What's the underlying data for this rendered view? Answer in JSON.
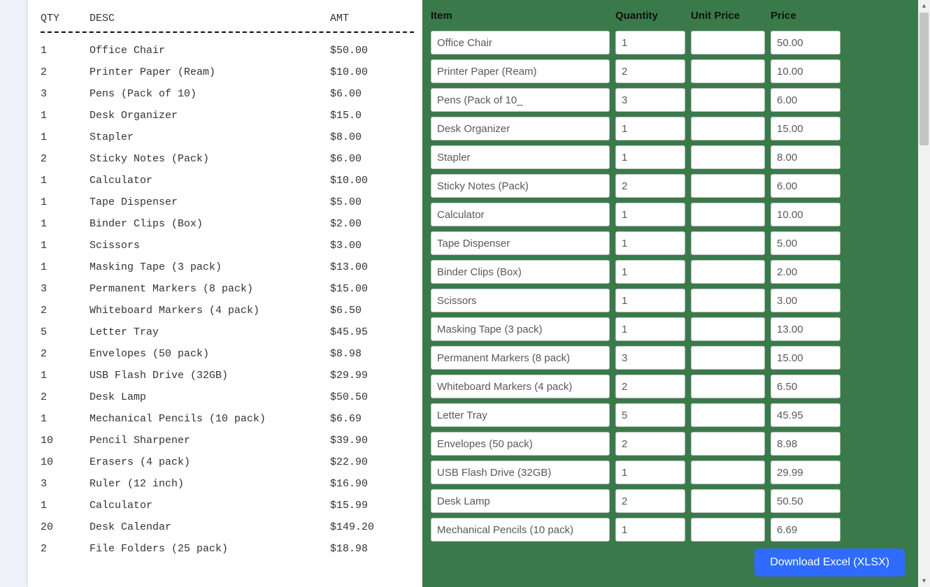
{
  "receipt": {
    "headers": {
      "qty": "QTY",
      "desc": "DESC",
      "amt": "AMT"
    },
    "rows": [
      {
        "qty": "1",
        "desc": "Office Chair",
        "amt": "$50.00"
      },
      {
        "qty": "2",
        "desc": "Printer Paper (Ream)",
        "amt": "$10.00"
      },
      {
        "qty": "3",
        "desc": "Pens (Pack of 10)",
        "amt": "$6.00"
      },
      {
        "qty": "1",
        "desc": "Desk Organizer",
        "amt": "$15.0"
      },
      {
        "qty": "1",
        "desc": "Stapler",
        "amt": "$8.00"
      },
      {
        "qty": "2",
        "desc": "Sticky Notes (Pack)",
        "amt": "$6.00"
      },
      {
        "qty": "1",
        "desc": "Calculator",
        "amt": "$10.00"
      },
      {
        "qty": "1",
        "desc": "Tape Dispenser",
        "amt": "$5.00"
      },
      {
        "qty": "1",
        "desc": "Binder Clips (Box)",
        "amt": "$2.00"
      },
      {
        "qty": "1",
        "desc": "Scissors",
        "amt": "$3.00"
      },
      {
        "qty": "1",
        "desc": "Masking Tape (3 pack)",
        "amt": "$13.00"
      },
      {
        "qty": "3",
        "desc": "Permanent Markers (8 pack)",
        "amt": "$15.00"
      },
      {
        "qty": "2",
        "desc": "Whiteboard Markers (4 pack)",
        "amt": "$6.50"
      },
      {
        "qty": "5",
        "desc": "Letter Tray",
        "amt": "$45.95"
      },
      {
        "qty": "2",
        "desc": "Envelopes (50 pack)",
        "amt": "$8.98"
      },
      {
        "qty": "1",
        "desc": "USB Flash Drive (32GB)",
        "amt": "$29.99"
      },
      {
        "qty": "2",
        "desc": "Desk Lamp",
        "amt": "$50.50"
      },
      {
        "qty": "1",
        "desc": "Mechanical Pencils (10 pack)",
        "amt": "$6.69"
      },
      {
        "qty": "10",
        "desc": "Pencil Sharpener",
        "amt": "$39.90"
      },
      {
        "qty": "10",
        "desc": "Erasers (4 pack)",
        "amt": "$22.90"
      },
      {
        "qty": "3",
        "desc": "Ruler (12 inch)",
        "amt": "$16.90"
      },
      {
        "qty": "1",
        "desc": "Calculator",
        "amt": "$15.99"
      },
      {
        "qty": "20",
        "desc": "Desk Calendar",
        "amt": "$149.20"
      },
      {
        "qty": "2",
        "desc": "File Folders (25 pack)",
        "amt": "$18.98"
      }
    ]
  },
  "editor": {
    "headers": {
      "item": "Item",
      "qty": "Quantity",
      "unit": "Unit Price",
      "price": "Price"
    },
    "download_label": "Download Excel (XLSX)",
    "rows": [
      {
        "item": "Office Chair",
        "qty": "1",
        "unit": "",
        "price": "50.00"
      },
      {
        "item": "Printer Paper (Ream)",
        "qty": "2",
        "unit": "",
        "price": "10.00"
      },
      {
        "item": "Pens (Pack of 10_",
        "qty": "3",
        "unit": "",
        "price": "6.00"
      },
      {
        "item": "Desk Organizer",
        "qty": "1",
        "unit": "",
        "price": "15.00"
      },
      {
        "item": "Stapler",
        "qty": "1",
        "unit": "",
        "price": "8.00"
      },
      {
        "item": "Sticky Notes (Pack)",
        "qty": "2",
        "unit": "",
        "price": "6.00"
      },
      {
        "item": "Calculator",
        "qty": "1",
        "unit": "",
        "price": "10.00"
      },
      {
        "item": "Tape Dispenser",
        "qty": "1",
        "unit": "",
        "price": "5.00"
      },
      {
        "item": "Binder Clips (Box)",
        "qty": "1",
        "unit": "",
        "price": "2.00"
      },
      {
        "item": "Scissors",
        "qty": "1",
        "unit": "",
        "price": "3.00"
      },
      {
        "item": "Masking Tape (3 pack)",
        "qty": "1",
        "unit": "",
        "price": "13.00"
      },
      {
        "item": "Permanent Markers (8 pack)",
        "qty": "3",
        "unit": "",
        "price": "15.00"
      },
      {
        "item": "Whiteboard Markers (4 pack)",
        "qty": "2",
        "unit": "",
        "price": "6.50"
      },
      {
        "item": "Letter Tray",
        "qty": "5",
        "unit": "",
        "price": "45.95"
      },
      {
        "item": "Envelopes (50 pack)",
        "qty": "2",
        "unit": "",
        "price": "8.98"
      },
      {
        "item": "USB Flash Drive (32GB)",
        "qty": "1",
        "unit": "",
        "price": "29.99"
      },
      {
        "item": "Desk Lamp",
        "qty": "2",
        "unit": "",
        "price": "50.50"
      },
      {
        "item": "Mechanical Pencils (10 pack)",
        "qty": "1",
        "unit": "",
        "price": "6.69"
      }
    ]
  }
}
